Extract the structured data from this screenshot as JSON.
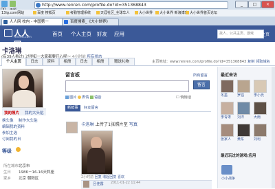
{
  "browser": {
    "url": "http://www.renren.com/profile.do?id=351368843",
    "desktop_icons": [
      "QQ",
      "无题"
    ],
    "window_buttons": [
      "_",
      "□",
      "×"
    ],
    "bookmarks": [
      "13ig.com网站",
      "百度 搜狐页",
      "考勤管理系统",
      "天涯社区_全球华人",
      "大小世界",
      "大小世界 新浪博客",
      "大小世界首页论坛"
    ],
    "tabs": [
      {
        "label": "人人网 校内 - 中国第一",
        "active": true
      },
      {
        "label": "百度搜索_《大小世界》",
        "active": false
      }
    ]
  },
  "nav": {
    "logo_cn": "人人网",
    "logo_en": "renren.com",
    "links": [
      "首页",
      "个人主页",
      "好友",
      "应用"
    ],
    "search_placeholder": "找人、公共主页、游戏",
    "home": "主页",
    "account": "帐号"
  },
  "profile": {
    "name": "卡洛琳",
    "status_text": "(有39人看过) 过得挺一大家都要开心呢～",
    "status_time": "4小时前",
    "status_link": "所有状态",
    "tabs": [
      "个人主页",
      "日志",
      "资料",
      "相册",
      "日志",
      "相册",
      "赠送礼物"
    ],
    "homepage_label": "主页地址：www.renren.com/profile.do?id=351368843",
    "homepage_copy": "复制",
    "homepage_shortlink": "领取域名"
  },
  "left": {
    "photo_tabs": [
      "我的照片",
      "我的大头贴"
    ],
    "links": [
      "换头像",
      "制作大头贴",
      "编辑我的资料",
      "参加主选",
      "订阅我的日"
    ],
    "grade_label": "等级",
    "info": [
      {
        "k": "所在城市",
        "v": "北京市"
      },
      {
        "k": "生日",
        "v": "1986－16-16天秤座"
      },
      {
        "k": "家乡",
        "v": "北京 朝阳区"
      }
    ]
  },
  "guestbook": {
    "title": "留言板",
    "all_link": "所有留言",
    "placeholder": "",
    "send": "留言",
    "tools": [
      "图片",
      "表情",
      "语音"
    ],
    "private_label": "悄悄话",
    "tabs": [
      "新鲜事",
      "好友留言"
    ]
  },
  "feed": {
    "user": "卡洛琳",
    "action": "上传了1张照片至",
    "album": "写真",
    "time": "2小时前",
    "reply": "回复",
    "share": "收起回复",
    "more": "喜欢",
    "comment_user": "吕佳露",
    "comment_time": "2011-01-22 11:44"
  },
  "right": {
    "recent_visitors_title": "最近来访",
    "visitors": [
      "冬墨",
      "罗强",
      "李小氏",
      "李青枣",
      "刘洋",
      "大雨",
      "张家人",
      "黄东",
      "刘利"
    ],
    "apps_title": "最近玩过的游戏/应用",
    "app_name": "小小战争"
  }
}
